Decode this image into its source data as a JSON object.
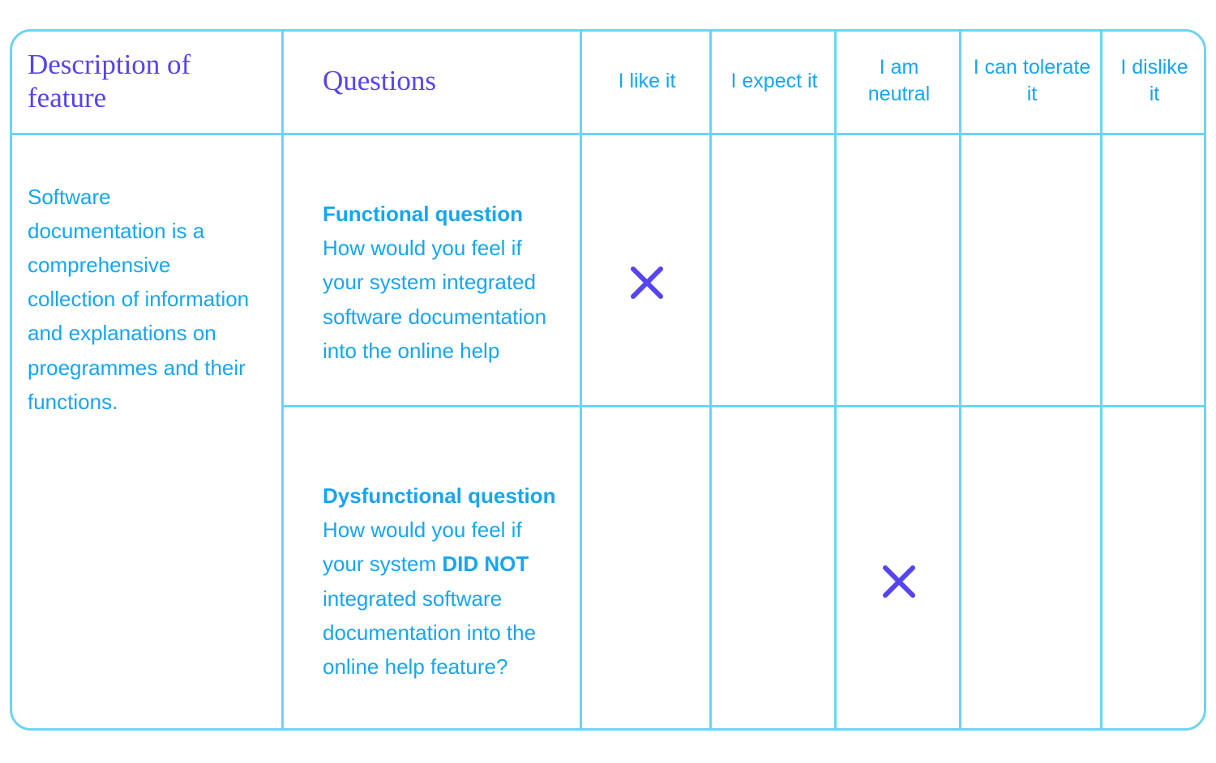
{
  "table": {
    "columns": [
      {
        "key": "description",
        "label": "Description of feature",
        "style": "serif-heading"
      },
      {
        "key": "questions",
        "label": "Questions",
        "style": "serif-heading"
      },
      {
        "key": "like",
        "label": "I like it",
        "style": "rating"
      },
      {
        "key": "expect",
        "label": "I expect it",
        "style": "rating"
      },
      {
        "key": "neutral",
        "label": "I am neutral",
        "style": "rating"
      },
      {
        "key": "tolerate",
        "label": "I can tolerate it",
        "style": "rating"
      },
      {
        "key": "dislike",
        "label": "I dislike it",
        "style": "rating"
      }
    ],
    "feature": {
      "description": "Software documentation is a comprehensive collection of information and explanations on proegrammes and their functions."
    },
    "rows": [
      {
        "id": "functional",
        "question_title": "Functional question",
        "question_text_before": "How would you feel if your system integrated software documentation into the online help",
        "question_emphasis": "",
        "question_text_after": "",
        "selected": "like",
        "marks": {
          "like": "x",
          "expect": "",
          "neutral": "",
          "tolerate": "",
          "dislike": ""
        }
      },
      {
        "id": "dysfunctional",
        "question_title": "Dysfunctional question",
        "question_text_before": "How would you feel if your system ",
        "question_emphasis": "DID NOT",
        "question_text_after": " integrated software documentation into the online help feature?",
        "selected": "neutral",
        "marks": {
          "like": "",
          "expect": "",
          "neutral": "x",
          "tolerate": "",
          "dislike": ""
        }
      }
    ]
  },
  "icons": {
    "mark": "x-icon"
  },
  "colors": {
    "border": "#6fd2f5",
    "heading_purple": "#5544f0",
    "body_blue": "#17a5f0",
    "mark_purple": "#5544f0",
    "background": "#ffffff"
  }
}
